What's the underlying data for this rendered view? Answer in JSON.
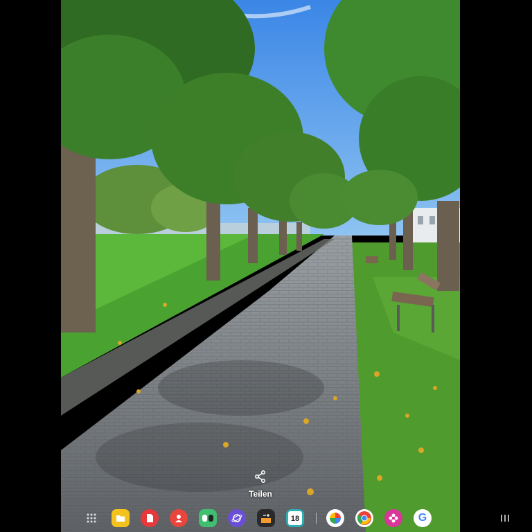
{
  "share": {
    "label": "Teilen",
    "icon": "share-icon"
  },
  "dock": {
    "apps": [
      {
        "name": "app-grid",
        "icon": "apps-grid-icon"
      },
      {
        "name": "my-files",
        "icon": "folder-icon",
        "color": "#f4c21c"
      },
      {
        "name": "notes",
        "icon": "note-icon",
        "color": "#e8383b"
      },
      {
        "name": "contacts",
        "icon": "contact-icon",
        "color": "#e8453c"
      },
      {
        "name": "game-launcher",
        "icon": "gamepad-icon",
        "color": "#3fbf6f"
      },
      {
        "name": "internet",
        "icon": "planet-icon",
        "color": "#6a4fd6"
      },
      {
        "name": "calculator",
        "icon": "calculator-icon",
        "color": "#2a2a2a"
      },
      {
        "name": "calendar",
        "icon": "calendar-icon",
        "color": "#2bb0b7",
        "day_label": "18"
      },
      {
        "name": "photos",
        "icon": "pinwheel-icon"
      },
      {
        "name": "chrome",
        "icon": "chrome-icon"
      },
      {
        "name": "gallery",
        "icon": "flower-icon",
        "color": "#d9359a"
      },
      {
        "name": "google",
        "icon": "google-g-icon",
        "letter": "G"
      }
    ]
  },
  "nav": {
    "recents_icon": "recents-icon"
  }
}
